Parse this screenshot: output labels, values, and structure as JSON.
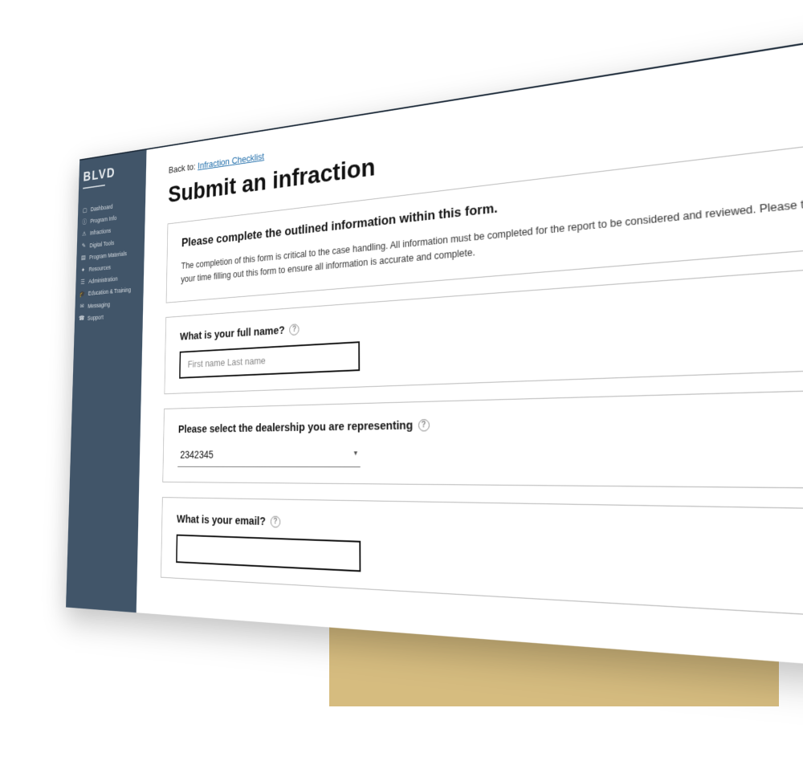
{
  "brand": "BLVD",
  "sidebar": {
    "items": [
      {
        "label": "Dashboard"
      },
      {
        "label": "Program Info"
      },
      {
        "label": "Infractions"
      },
      {
        "label": "Digital Tools"
      },
      {
        "label": "Program Materials"
      },
      {
        "label": "Resources"
      },
      {
        "label": "Administration"
      },
      {
        "label": "Education & Training"
      },
      {
        "label": "Messaging"
      },
      {
        "label": "Support"
      }
    ]
  },
  "back": {
    "prefix": "Back to: ",
    "link": "Infraction Checklist"
  },
  "page_title": "Submit an infraction",
  "intro": {
    "lead": "Please complete the outlined information within this form.",
    "body": "The completion of this form is critical to the case handling. All information must be completed for the report to be considered and reviewed. Please take your time filling out this form to ensure all information is accurate and complete."
  },
  "fields": {
    "full_name": {
      "label": "What is your full name?",
      "placeholder": "First name Last name"
    },
    "dealership": {
      "label": "Please select the dealership you are representing",
      "value": "2342345"
    },
    "email": {
      "label": "What is your email?"
    }
  },
  "icons": {
    "help": "?",
    "caret": "▾"
  }
}
